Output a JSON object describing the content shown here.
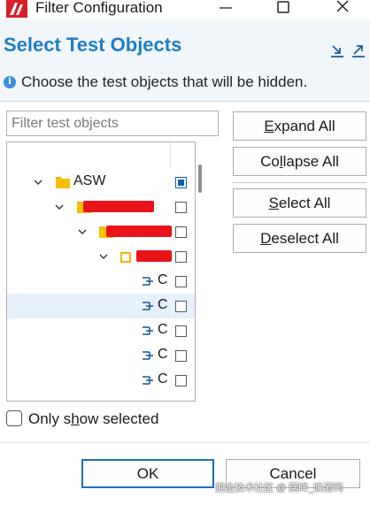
{
  "window": {
    "title": "Filter Configuration"
  },
  "header": {
    "heading": "Select Test Objects",
    "info": "Choose the test objects that will be hidden."
  },
  "filter": {
    "placeholder": "Filter test objects",
    "value": ""
  },
  "tree": {
    "root": {
      "label": "ASW",
      "checked": true
    },
    "nodes": [
      {
        "label": "",
        "redacted": true,
        "checked": false
      },
      {
        "label": "",
        "redacted": true,
        "checked": false
      },
      {
        "label": "",
        "redacted": true,
        "checked": false
      }
    ],
    "leaves": [
      {
        "label": "C",
        "checked": false,
        "selected": false
      },
      {
        "label": "C",
        "checked": false,
        "selected": true
      },
      {
        "label": "C",
        "checked": false,
        "selected": false
      },
      {
        "label": "C",
        "checked": false,
        "selected": false
      },
      {
        "label": "C",
        "checked": false,
        "selected": false
      }
    ]
  },
  "buttons": {
    "expand_all": {
      "pre": "",
      "u": "E",
      "post": "xpand All"
    },
    "collapse_all": {
      "pre": "Co",
      "u": "l",
      "post": "lapse All"
    },
    "select_all": {
      "pre": "",
      "u": "S",
      "post": "elect All"
    },
    "deselect_all": {
      "pre": "",
      "u": "D",
      "post": "eselect All"
    },
    "ok": "OK",
    "cancel": "Cancel"
  },
  "only_show_selected": {
    "pre": "Only s",
    "u": "h",
    "post": "ow selected",
    "checked": false
  },
  "watermark": "掘金技术社区 @ 回眸_晚酒鸭",
  "colors": {
    "accent": "#1f7ec6",
    "folder": "#f0b400",
    "redaction": "#e8141a",
    "selected_row": "#e6f0fa"
  }
}
